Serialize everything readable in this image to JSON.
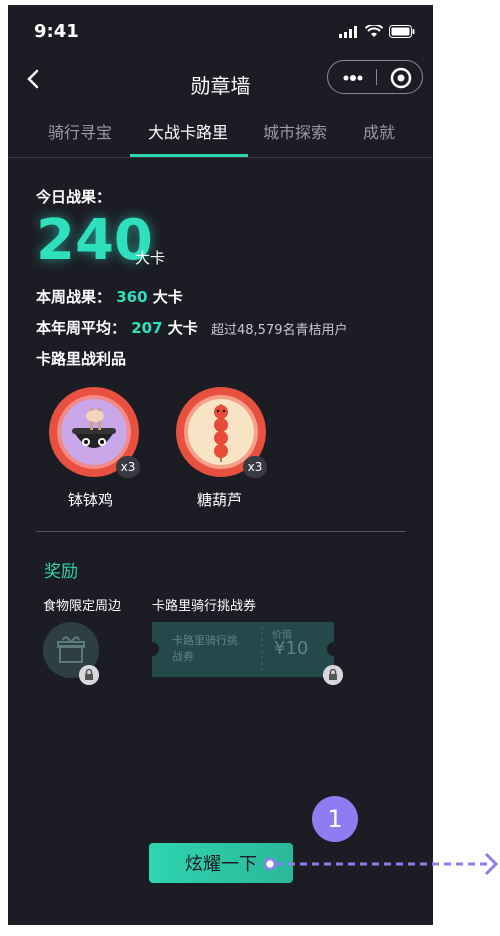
{
  "status_bar": {
    "time": "9:41"
  },
  "navbar": {
    "title": "勋章墙"
  },
  "tabs": [
    {
      "label": "骑行寻宝"
    },
    {
      "label": "大战卡路里"
    },
    {
      "label": "城市探索"
    },
    {
      "label": "成就"
    }
  ],
  "stats": {
    "today_label": "今日战果：",
    "today_value": "240",
    "today_unit": "大卡",
    "week_label": "本周战果：",
    "week_value": "360",
    "week_unit": "大卡",
    "year_label": "本年周平均：",
    "year_value": "207",
    "year_unit": "大卡",
    "year_compare": "超过48,579名青桔用户"
  },
  "loot": {
    "title": "卡路里战利品",
    "items": [
      {
        "name": "钵钵鸡",
        "count": "x3"
      },
      {
        "name": "糖葫芦",
        "count": "x3"
      }
    ]
  },
  "reward": {
    "title": "奖励",
    "items": [
      {
        "label": "食物限定周边"
      },
      {
        "label": "卡路里骑行挑战券",
        "ticket_name": "卡路里骑行挑战券",
        "value_label": "价值",
        "value": "¥10"
      }
    ]
  },
  "cta": {
    "label": "炫耀一下"
  },
  "annotation": {
    "number": "1"
  },
  "colors": {
    "accent": "#2fd4b0",
    "background": "#1c1c24",
    "marker": "#8f7cf0"
  }
}
